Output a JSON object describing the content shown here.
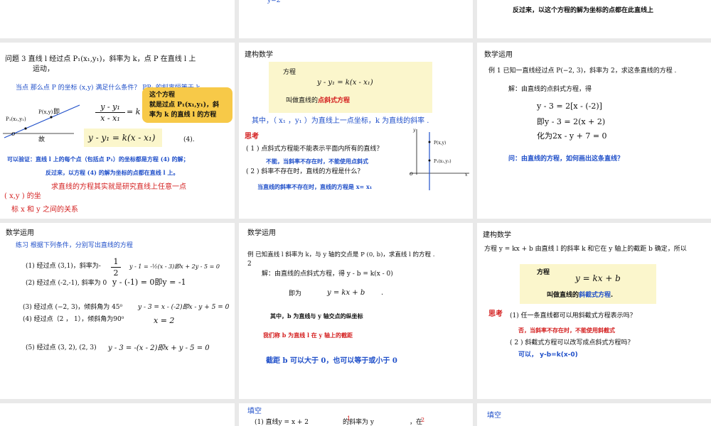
{
  "s_top2": {
    "partial": "y=2"
  },
  "s_top3": {
    "text": "反过来，以这个方程的解为坐标的点都在此直线上"
  },
  "s4": {
    "q": "问题 3  直线 l 经过点 P₁(x₁,y₁)，斜率为 k，点 P 在直线 l 上",
    "q2": "运动，",
    "ask": "当点   那么点 P 的坐标 (x,y) 满足什么条件？   PP₁ 的斜率恒等于 k",
    "bubble1": "这个方程",
    "bubble2": "就是过点 P₁(x₁,y₁)，斜",
    "bubble3": "率为 k 的直线 l 的方程",
    "p_label": "P(x,y)",
    "p1_label": "P₁(x₁,y₁)",
    "o_label": "o",
    "ji": "即",
    "frac_num": "y - y₁",
    "frac_den": "x - x₁",
    "frac_eq": "= k",
    "gu": "故",
    "formula": "y - y₁ = k(x - x₁)",
    "formula_no": "(4).",
    "verify1": "可以验证：直线 l 上的每个点（包括点 P₁）的坐标都是方程 (4) 的解；",
    "verify2": "反过来，以方程 (4) 的解为坐标的点都在直线 l 上。",
    "note1": "求直线的方程其实就是研究直线上任意一点",
    "note2": "( x,y ) 的坐",
    "note3": "标 x 和 y 之间的关系"
  },
  "s5": {
    "title": "建构数学",
    "box_label": "方程",
    "box_formula": "y - y₁ = k(x - x₁)",
    "called": "叫做直线的",
    "called_name": "点斜式方程",
    "where": "其中，（ x₁ ，y₁ ）为直线上一点坐标，k 为直线的斜率 .",
    "think": "思考",
    "q1": "( 1 ) 点斜式方程能不能表示平面内所有的直线？",
    "a1": "不能，当斜率不存在时，不能使用点斜式",
    "q2": "( 2 ) 斜率不存在时，直线的方程是什么？",
    "a2": "当直线的斜率不存在时，直线的方程是  x= x₁",
    "p_label": "P(x,y)",
    "p1_label": "P₁(x₁,y₁)",
    "o_label": "o",
    "y_label": "y",
    "x_label": "x"
  },
  "s6": {
    "title": "数学运用",
    "ex": "例 1 已知一直线经过点 P(−2, 3)，斜率为 2，求这条直线的方程 .",
    "sol": "解：由直线的点斜式方程，得",
    "l1": "y - 3 = 2[x - (-2)]",
    "l2": "即y - 3 = 2(x + 2)",
    "l3": "化为2x - y + 7 = 0",
    "ask": "问：由直线的方程，如何画出这条直线？"
  },
  "s7": {
    "title": "数学运用",
    "sub": "练习   根据下列条件，分别写出直线的方程",
    "i1": "(1)  经过点 (3,1)，斜率为-",
    "i1_frac_num": "1",
    "i1_frac_den": "2",
    "i1_ans": "y - 1 = -½(x - 3)即x + 2y - 5 = 0",
    "i2": "(2) 经过点 (-2,-1), 斜率为 0",
    "i2_ans": "y - (-1) = 0即y = -1",
    "i3": "(3)  经过点 (−2, 3)，倾斜角为  45⁰",
    "i3_ans": "y - 3 = x - (-2)即x - y + 5 = 0",
    "i4": "(4)  经过点（2 ， 1），倾斜角为90⁰",
    "i4_ans": "x = 2",
    "i5": "(5)  经过点 (3, 2), (2, 3)",
    "i5_ans": "y - 3 = -(x - 2)即x + y - 5 = 0"
  },
  "s8": {
    "title": "数学运用",
    "ex": "例 已知直线 l  斜率为 k，与 y 轴的交点是 P (0, b)，求直线  l 的方程 .",
    "ex_no": "2",
    "sol": "解：由直线的点斜式方程，得 y - b = k(x - 0)",
    "ji": "即为",
    "eq": "y = kx + b",
    "dot": ".",
    "note1": "其中，b 为直线与 y 轴交点的纵坐标",
    "note2": "我们称 b 为直线 l 在 y 轴上的截距",
    "note3": "截距 b 可以大于 0，也可以等于或小于 0"
  },
  "s9": {
    "title": "建构数学",
    "line1": "方程    y = kx + b 由直线 l 的斜率 k 和它在 y 轴上的截距 b 确定，所以",
    "box_label": "方程",
    "box_formula": "y = kx + b",
    "called": "叫做直线的",
    "called_name": "斜截式方程",
    "called_end": ".",
    "think": "思考",
    "q1": "(1)  任一条直线都可以用斜截式方程表示吗？",
    "a1": "否，当斜率不存在时，不能使用斜截式",
    "q2": "( 2 ) 斜截式方程可以改写成点斜式方程吗？",
    "a2": "可以， y-b=k(x-0)"
  },
  "s11": {
    "title": "填空",
    "line": "(1) 直线y = x + 2",
    "mid": "的斜率为 y",
    "tail": "，在",
    "sup1": "1",
    "sup2": "2"
  },
  "s12": {
    "title": "填空"
  }
}
